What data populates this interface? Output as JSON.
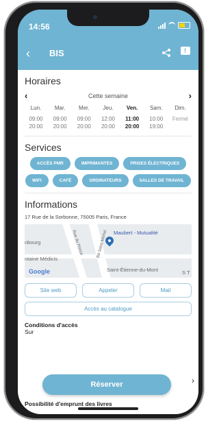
{
  "status": {
    "time": "14:56"
  },
  "nav": {
    "title": "BIS"
  },
  "hours": {
    "title": "Horaires",
    "week_label": "Cette semaine",
    "days": [
      {
        "name": "Lun.",
        "open": "09:00",
        "close": "20:00"
      },
      {
        "name": "Mar.",
        "open": "09:00",
        "close": "20:00"
      },
      {
        "name": "Mer.",
        "open": "09:00",
        "close": "20:00"
      },
      {
        "name": "Jeu.",
        "open": "12:00",
        "close": "20:00"
      },
      {
        "name": "Ven.",
        "open": "11:00",
        "close": "20:00"
      },
      {
        "name": "Sam.",
        "open": "10:00",
        "close": "19:00"
      },
      {
        "name": "Dim.",
        "closed": "Fermé"
      }
    ]
  },
  "services": {
    "title": "Services",
    "items": [
      "ACCÈS PMR",
      "IMPRIMANTES",
      "PRISES ÉLECTRIQUES",
      "WIFI",
      "CAFÉ",
      "ORDINATEURS",
      "SALLES DE TRAVAIL"
    ]
  },
  "info": {
    "title": "Informations",
    "address": "17 Rue de la Sorbonne, 75005 Paris, France",
    "map_labels": {
      "metro": "Maubert - Mutualité",
      "left1": "nbourg",
      "left2": "ntaine Médicis",
      "road1": "Rue du Prince",
      "road2": "Bd Saint-Michel",
      "bottom": "Saint-Étienne-du-Mont",
      "google": "Google",
      "edge": "S T"
    },
    "buttons": {
      "website": "Site web",
      "call": "Appeler",
      "mail": "Mail",
      "catalog": "Accès au catalogue"
    }
  },
  "conditions": {
    "label": "Conditions d'accès",
    "sub": "Sur"
  },
  "reserve_label": "Réserver",
  "borrow_label": "Possibilité d'emprunt des livres",
  "colors": {
    "accent": "#6fb4d2",
    "battery": "#f5d400"
  }
}
